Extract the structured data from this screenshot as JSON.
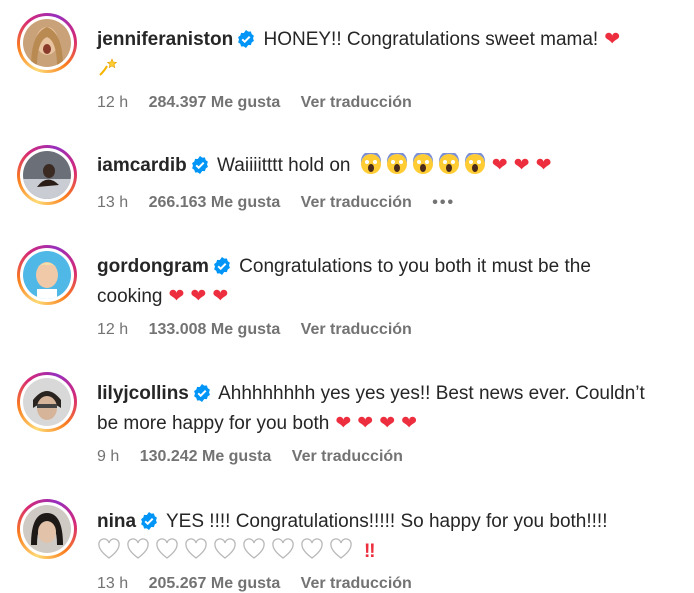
{
  "comments": [
    {
      "username": "jenniferaniston",
      "text": "HONEY!! Congratulations sweet mama!",
      "time": "12 h",
      "likes": "284.397 Me gusta",
      "translate": "Ver traducción"
    },
    {
      "username": "iamcardib",
      "text": "Waiiiitttt hold on",
      "time": "13 h",
      "likes": "266.163 Me gusta",
      "translate": "Ver traducción",
      "more": "•••"
    },
    {
      "username": "gordongram",
      "text": "Congratulations to you both it must be the",
      "text2": "cooking",
      "time": "12 h",
      "likes": "133.008 Me gusta",
      "translate": "Ver traducción"
    },
    {
      "username": "lilyjcollins",
      "text": "Ahhhhhhhh yes yes yes!! Best news ever. Couldn’t",
      "text2": "be more happy for you both",
      "time": "9 h",
      "likes": "130.242 Me gusta",
      "translate": "Ver traducción"
    },
    {
      "username": "nina",
      "text": "YES !!!! Congratulations!!!!! So happy for you both!!!!",
      "time": "13 h",
      "likes": "205.267 Me gusta",
      "translate": "Ver traducción"
    }
  ],
  "colors": {
    "verified": "#0095f6",
    "heart": "#ed2e3e",
    "meta": "#737373"
  }
}
